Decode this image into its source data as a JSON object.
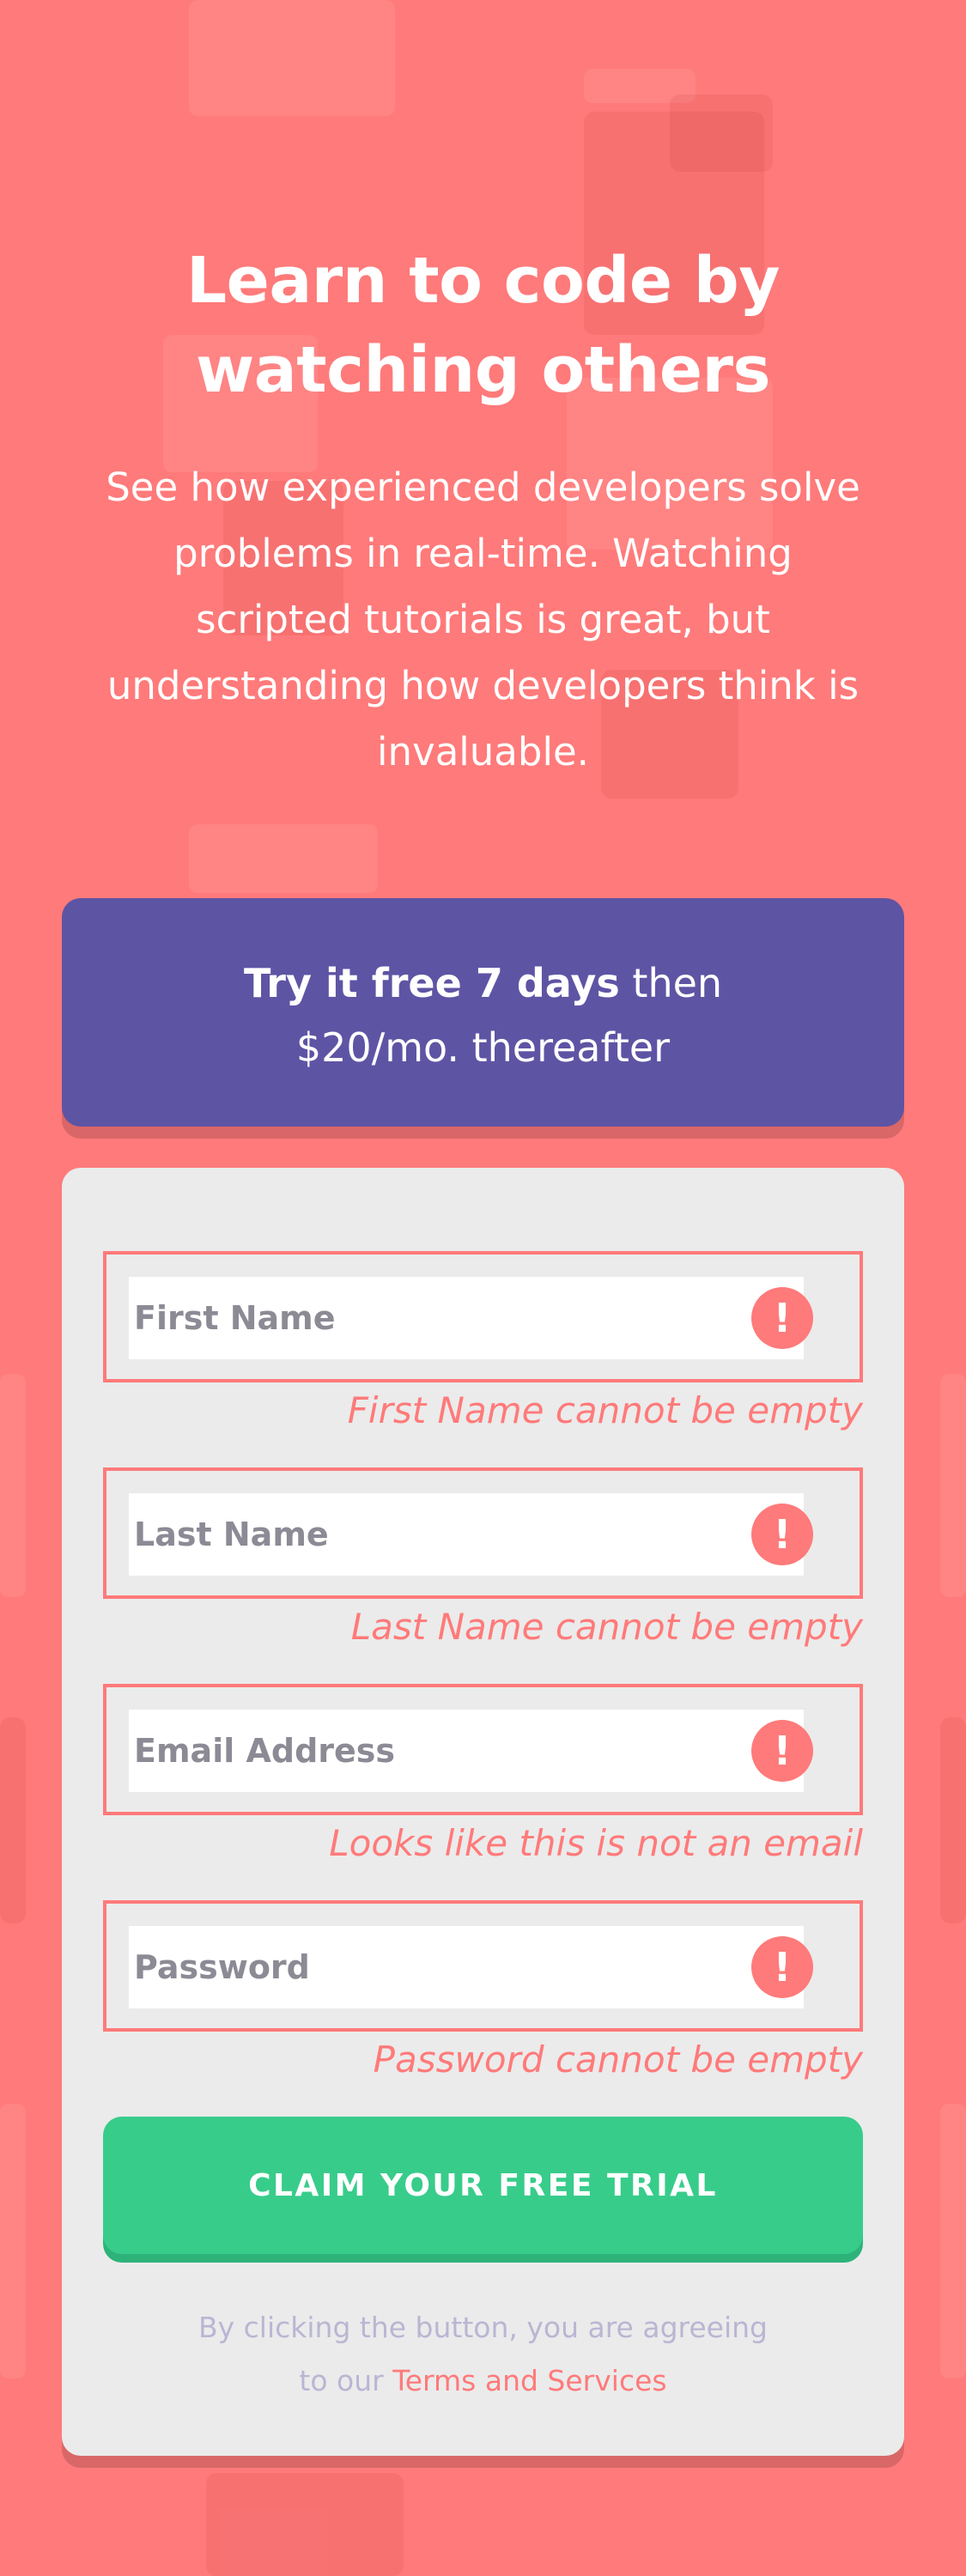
{
  "hero": {
    "title_line1": "Learn to code by",
    "title_line2": "watching others",
    "description_line1": "See how experienced developers solve",
    "description_line2": "problems in real-time. Watching",
    "description_line3": "scripted tutorials is great, but",
    "description_line4": "understanding how developers think is",
    "description_line5": "invaluable."
  },
  "promo": {
    "bold": "Try it free 7 days",
    "rest": " then",
    "line2": "$20/mo. thereafter"
  },
  "form": {
    "fields": [
      {
        "placeholder": "First Name",
        "value": "",
        "error": "First Name cannot be empty",
        "icon": "!"
      },
      {
        "placeholder": "Last Name",
        "value": "",
        "error": "Last Name cannot be empty",
        "icon": "!"
      },
      {
        "placeholder": "Email Address",
        "value": "",
        "error": "Looks like this is not an email",
        "icon": "!"
      },
      {
        "placeholder": "Password",
        "value": "",
        "error": "Password cannot be empty",
        "icon": "!"
      }
    ],
    "submit_label": "CLAIM YOUR FREE TRIAL",
    "terms_line1": "By clicking the button, you are agreeing",
    "terms_prefix": "to our ",
    "terms_link": "Terms and Services"
  },
  "colors": {
    "background": "#ff7a7a",
    "promo": "#5e54a4",
    "card": "#ebebeb",
    "cta": "#38cc8b",
    "error": "#ff7a7a",
    "terms_text": "#b9b6d3"
  },
  "icons": {
    "field_error": "error-icon"
  }
}
